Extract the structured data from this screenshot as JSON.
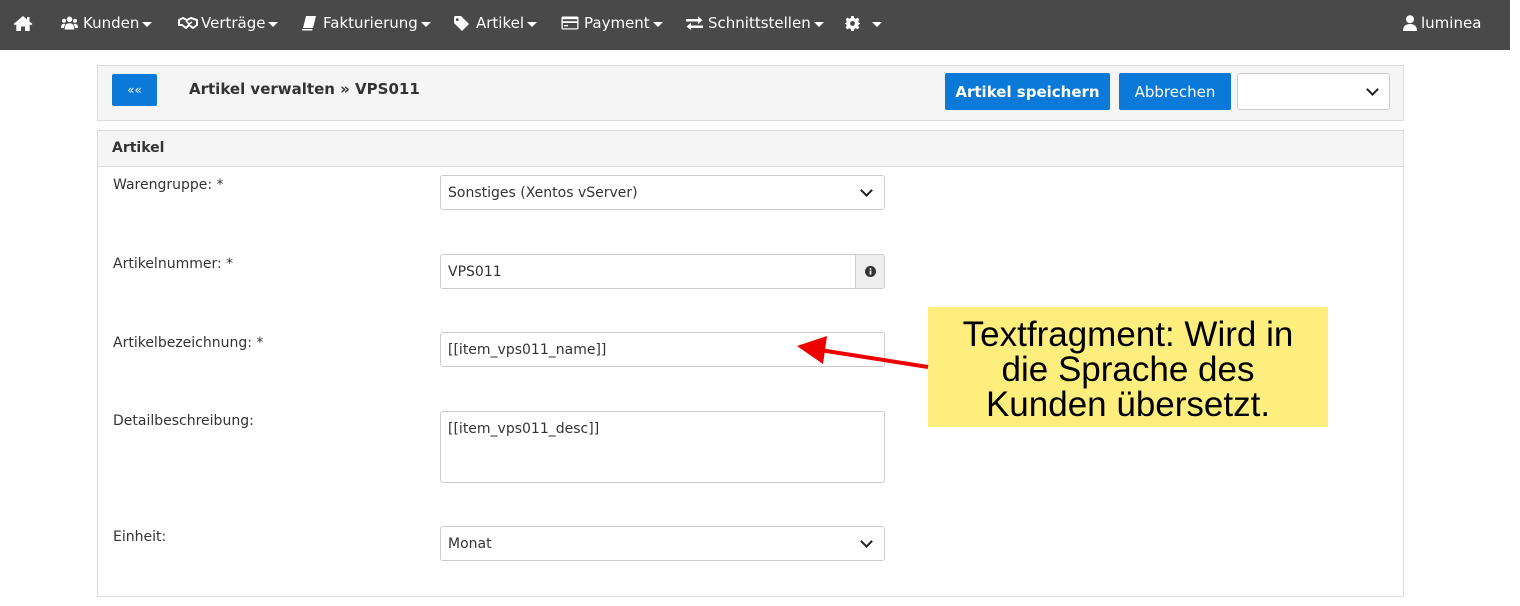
{
  "nav": {
    "home_icon": "home-icon",
    "items": [
      {
        "label": "Kunden",
        "icon": "users-icon"
      },
      {
        "label": "Verträge",
        "icon": "handshake-icon"
      },
      {
        "label": "Fakturierung",
        "icon": "book-icon"
      },
      {
        "label": "Artikel",
        "icon": "tags-icon"
      },
      {
        "label": "Payment",
        "icon": "credit-card-icon"
      },
      {
        "label": "Schnittstellen",
        "icon": "exchange-icon"
      },
      {
        "label": "",
        "icon": "gear-icon"
      }
    ],
    "user": {
      "label": "luminea",
      "icon": "user-icon"
    }
  },
  "header": {
    "back_label": "««",
    "title": "Artikel verwalten » VPS011",
    "save_label": "Artikel speichern",
    "cancel_label": "Abbrechen",
    "select_value": ""
  },
  "panel": {
    "title": "Artikel",
    "fields": {
      "warengruppe": {
        "label": "Warengruppe: *",
        "value": "Sonstiges (Xentos vServer)"
      },
      "artikelnummer": {
        "label": "Artikelnummer: *",
        "value": "VPS011"
      },
      "artikelbezeichnung": {
        "label": "Artikelbezeichnung: *",
        "value": "[[item_vps011_name]]"
      },
      "detailbeschreibung": {
        "label": "Detailbeschreibung:",
        "value": "[[item_vps011_desc]]"
      },
      "einheit": {
        "label": "Einheit:",
        "value": "Monat"
      }
    }
  },
  "annotation": {
    "line1": "Textfragment: Wird in",
    "line2": "die Sprache des",
    "line3": "Kunden übersetzt."
  },
  "colors": {
    "navbar": "#494949",
    "primary": "#0a79d8",
    "annotation_bg": "#fdee7e",
    "arrow": "#ee0000"
  }
}
